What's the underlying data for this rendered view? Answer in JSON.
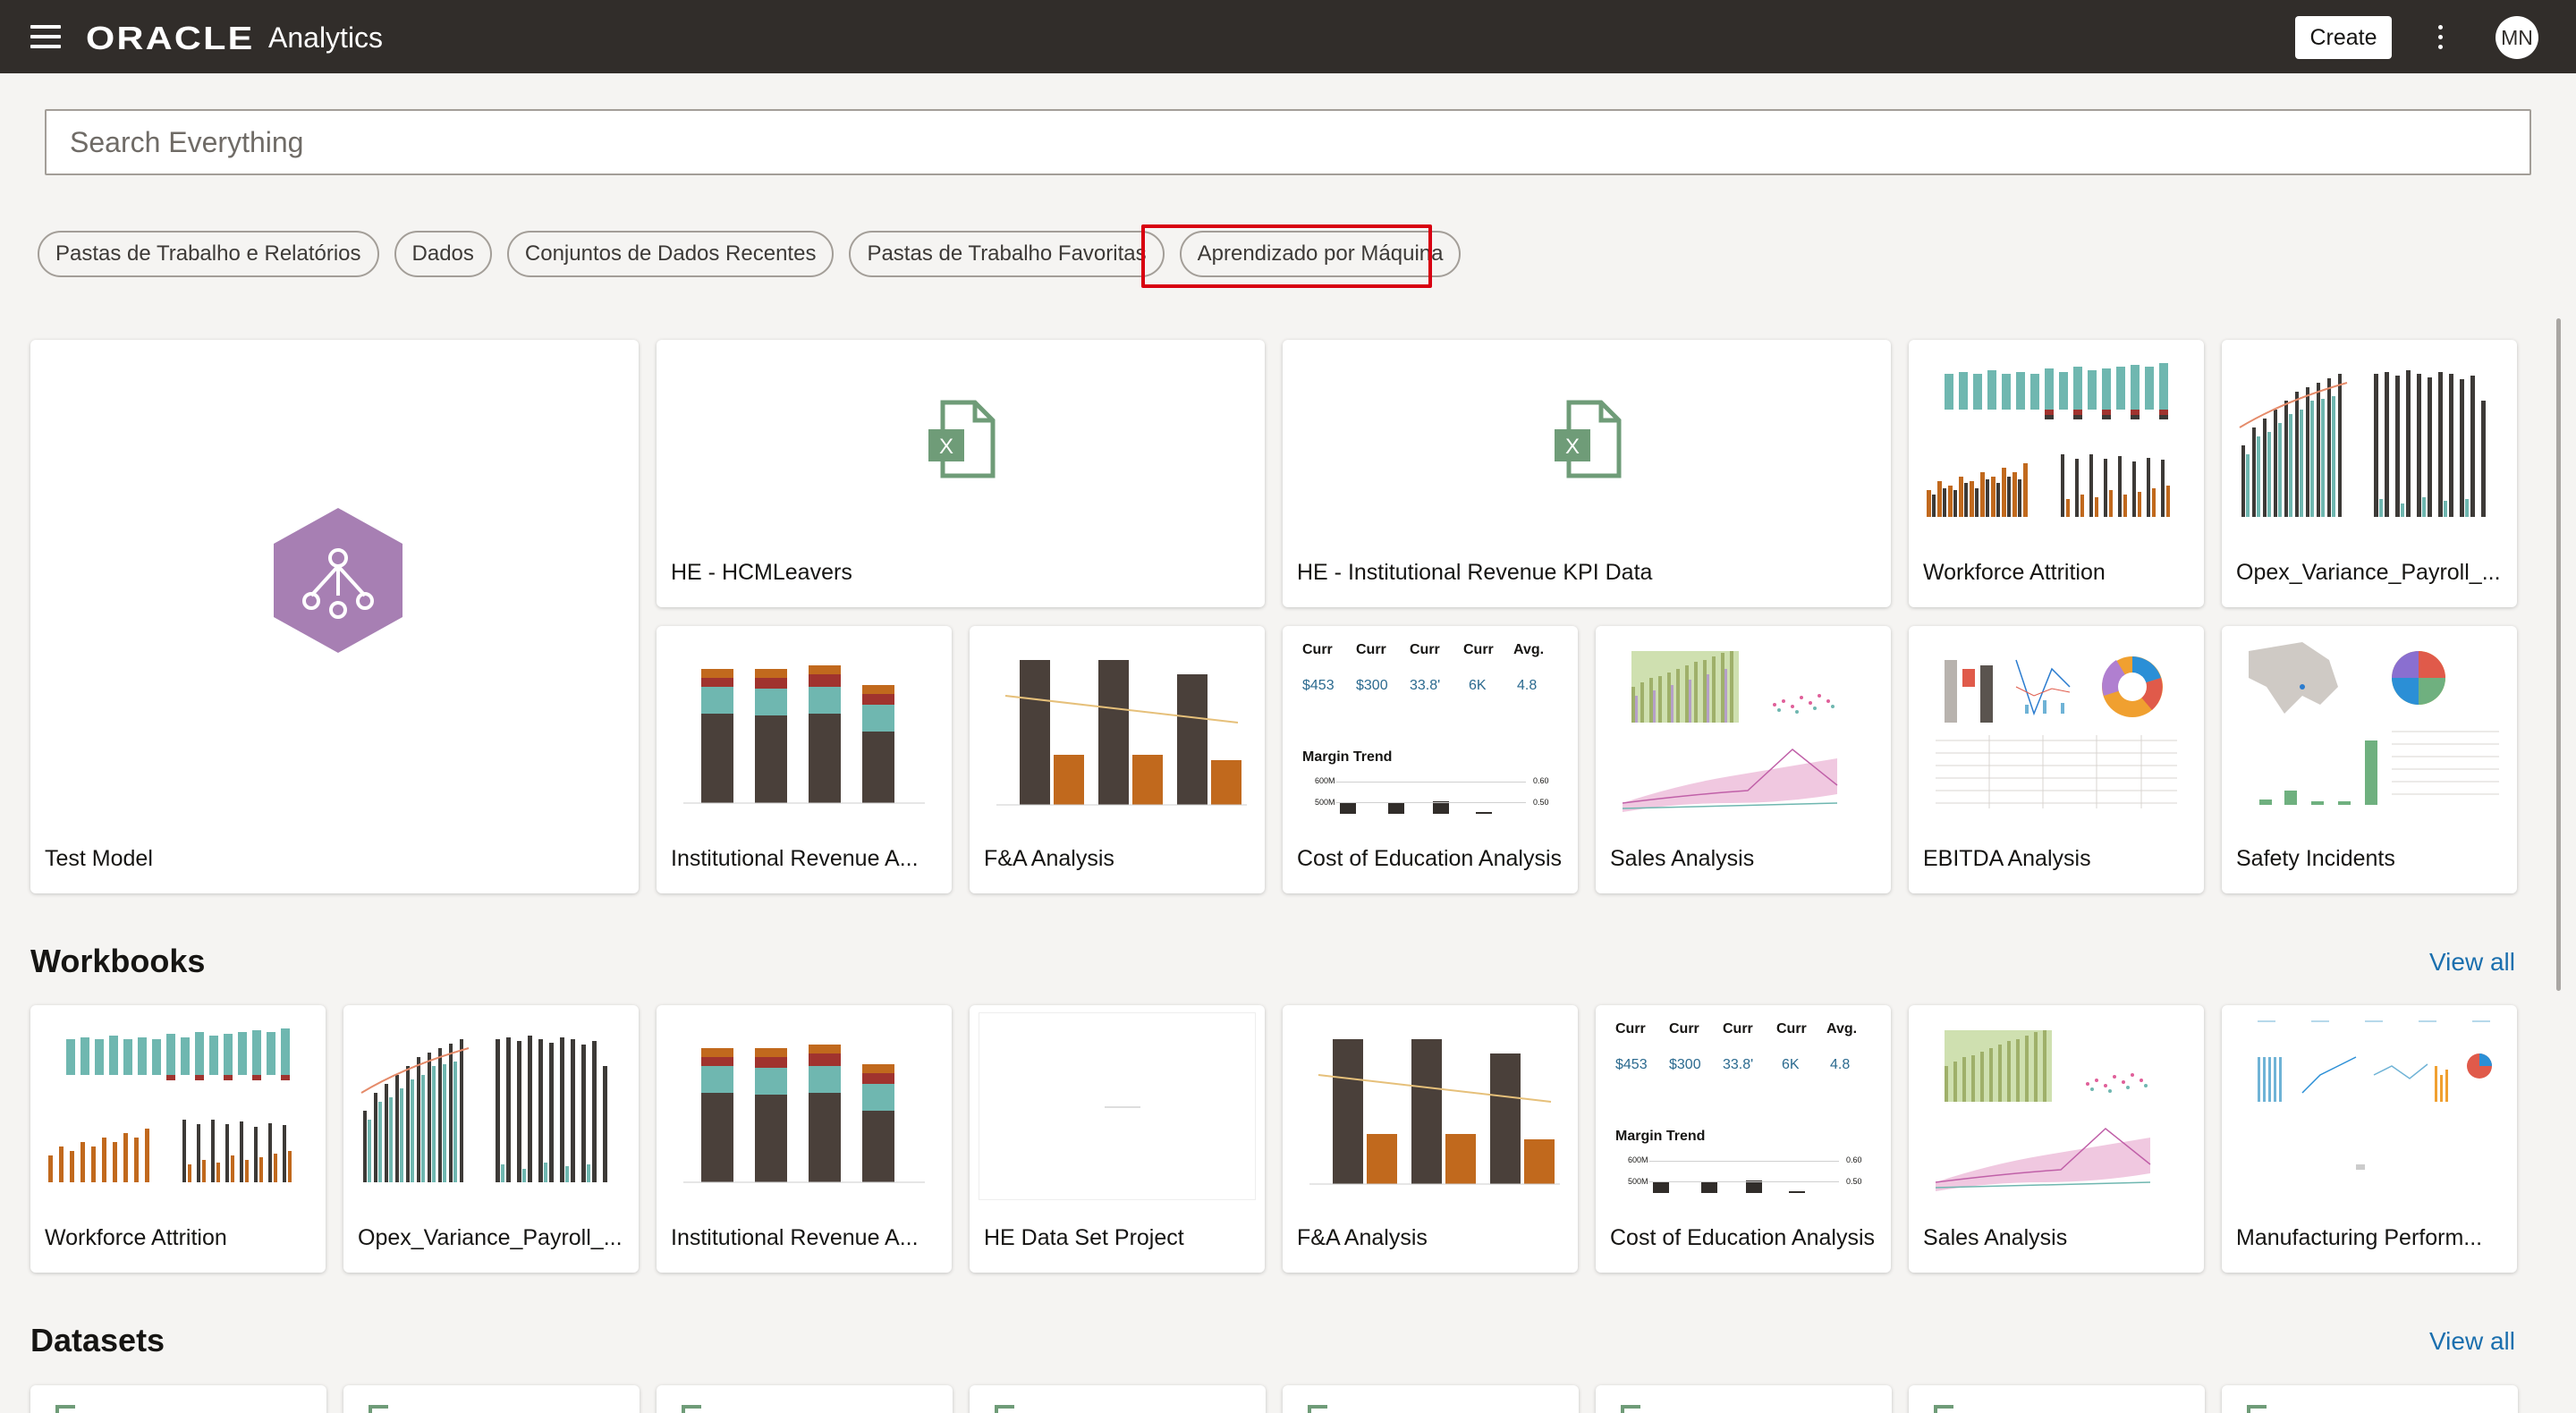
{
  "header": {
    "brand_oracle": "ORACLE",
    "brand_app": "Analytics",
    "create_label": "Create",
    "avatar_initials": "MN"
  },
  "search": {
    "placeholder": "Search Everything"
  },
  "filters": [
    "Pastas de Trabalho e Relatórios",
    "Dados",
    "Conjuntos de Dados Recentes",
    "Pastas de Trabalho Favoritas",
    "Aprendizado por Máquina"
  ],
  "recent": {
    "large": {
      "title": "Test Model",
      "icon": "ml-model-icon"
    },
    "row1": [
      {
        "title": "HE - HCMLeavers",
        "icon": "excel-file-icon"
      },
      {
        "title": "HE - Institutional Revenue KPI Data",
        "icon": "excel-file-icon"
      },
      {
        "title": "Workforce Attrition"
      },
      {
        "title": "Opex_Variance_Payroll_..."
      }
    ],
    "row2": [
      {
        "title": "Institutional Revenue A..."
      },
      {
        "title": "F&A Analysis"
      },
      {
        "title": "Cost of Education Analysis"
      },
      {
        "title": "Sales Analysis"
      },
      {
        "title": "EBITDA Analysis"
      },
      {
        "title": "Safety Incidents"
      }
    ]
  },
  "kpi_thumbnail": {
    "headers": [
      "Curr",
      "Curr",
      "Curr",
      "Curr",
      "Avg."
    ],
    "values": [
      "$453",
      "$300",
      "33.8'",
      "6K",
      "4.8"
    ],
    "trend_title": "Margin Trend",
    "axis_left": [
      "600M",
      "500M"
    ],
    "axis_right": [
      "0.60",
      "0.50"
    ]
  },
  "workbooks": {
    "title": "Workbooks",
    "view_all": "View all",
    "items": [
      {
        "title": "Workforce Attrition"
      },
      {
        "title": "Opex_Variance_Payroll_..."
      },
      {
        "title": "Institutional Revenue A..."
      },
      {
        "title": "HE Data Set Project"
      },
      {
        "title": "F&A Analysis"
      },
      {
        "title": "Cost of Education Analysis"
      },
      {
        "title": "Sales Analysis"
      },
      {
        "title": "Manufacturing Perform..."
      }
    ]
  },
  "datasets": {
    "title": "Datasets",
    "view_all": "View all"
  },
  "colors": {
    "header_bg": "#312d2a",
    "accent_link": "#1b6fae",
    "highlight": "#d80010",
    "ml_purple": "#a77fb3",
    "excel_green": "#6f9c78"
  }
}
